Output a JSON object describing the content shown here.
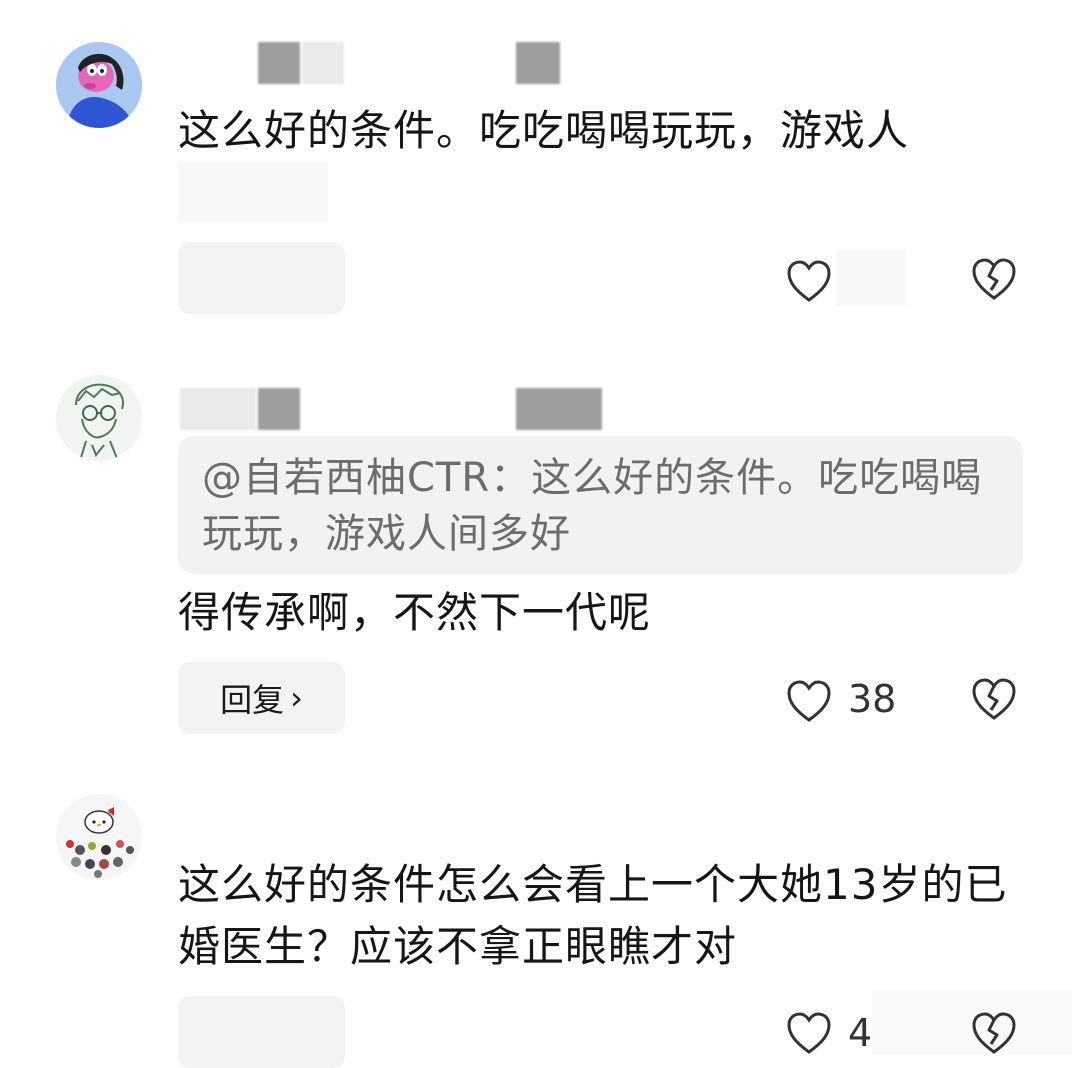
{
  "comments": [
    {
      "text": "这么好的条件。吃吃喝喝玩玩，游戏人",
      "quote": "",
      "reply_label": "",
      "like_count": ""
    },
    {
      "text": "得传承啊，不然下一代呢",
      "quote": "@自若西柚CTR：这么好的条件。吃吃喝喝玩玩，游戏人间多好",
      "reply_label": "回复",
      "like_count": "38"
    },
    {
      "text": "这么好的条件怎么会看上一个大她13岁的已婚医生？应该不拿正眼瞧才对",
      "quote": "",
      "reply_label": "",
      "like_count": "4"
    }
  ],
  "icons": {
    "like": "heart-outline-icon",
    "dislike": "broken-heart-icon",
    "chevron": "chevron-right-icon"
  },
  "colors": {
    "text": "#161616",
    "quote_text": "#6c6c6c",
    "quote_bg": "#f2f2f2",
    "button_bg": "#f3f3f3",
    "icon": "#333333"
  }
}
